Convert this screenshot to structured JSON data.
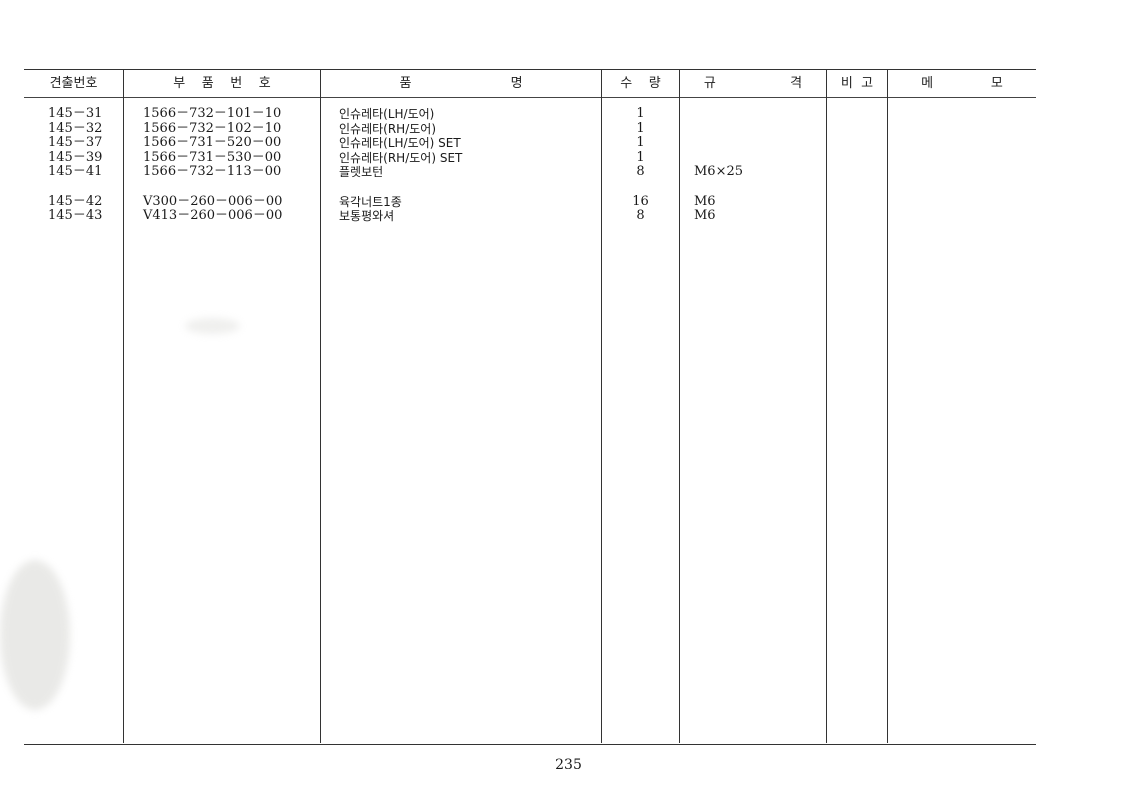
{
  "header": {
    "col_no": "견출번호",
    "col_part": "부    품    번    호",
    "col_name": "품                        명",
    "col_qty": "수    량",
    "col_spec": "규                  격",
    "col_note": "비  고",
    "col_memo": "메              모"
  },
  "rows": [
    {
      "no": "145－31",
      "part": "1566－732－101－10",
      "name": "인슈레타(LH/도어)",
      "qty": "1",
      "spec": ""
    },
    {
      "no": "145－32",
      "part": "1566－732－102－10",
      "name": "인슈레타(RH/도어)",
      "qty": "1",
      "spec": ""
    },
    {
      "no": "145－37",
      "part": "1566－731－520－00",
      "name": "인슈레타(LH/도어) SET",
      "qty": "1",
      "spec": ""
    },
    {
      "no": "145－39",
      "part": "1566－731－530－00",
      "name": "인슈레타(RH/도어) SET",
      "qty": "1",
      "spec": ""
    },
    {
      "no": "145－41",
      "part": "1566－732－113－00",
      "name": "플렛보턴",
      "qty": "8",
      "spec": "M6×25"
    },
    {
      "no": "145－42",
      "part": "V300－260－006－00",
      "name": "육각너트1종",
      "qty": "16",
      "spec": "M6"
    },
    {
      "no": "145－43",
      "part": "V413－260－006－00",
      "name": "보통평와셔",
      "qty": "8",
      "spec": "M6"
    }
  ],
  "footer": {
    "page_number": "235"
  }
}
